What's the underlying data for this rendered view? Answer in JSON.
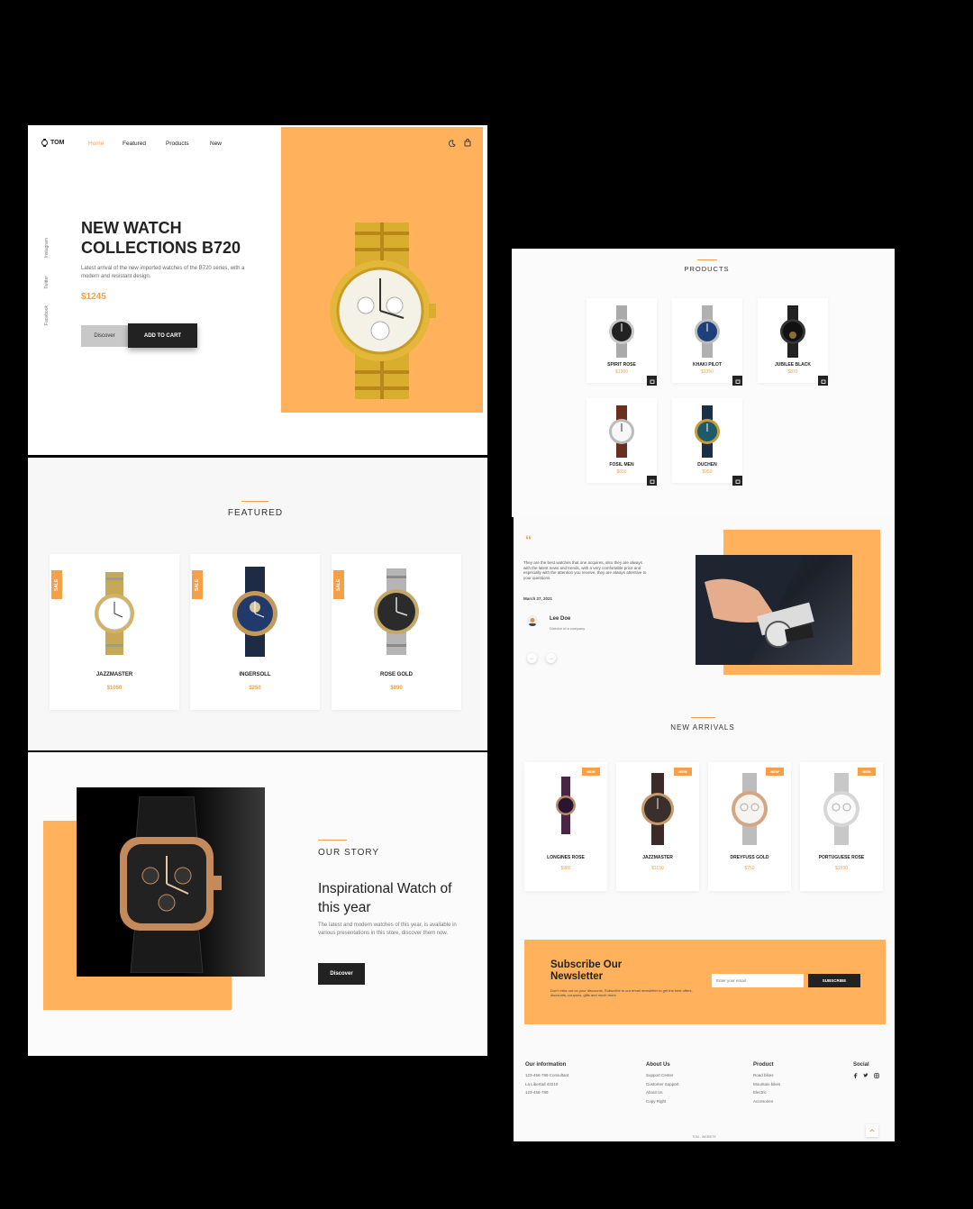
{
  "colors": {
    "accent": "#f4a04a",
    "orange_block": "#ffb25b",
    "dark_button": "#1f1f1f",
    "background": "#000000"
  },
  "header": {
    "logo": "TOM",
    "nav": [
      "Home",
      "Featured",
      "Products",
      "New"
    ],
    "active_nav": "Home",
    "icons": [
      "moon-icon",
      "bag-icon"
    ]
  },
  "hero": {
    "title_line1": "NEW WATCH",
    "title_line2": "COLLECTIONS B720",
    "description": "Latest arrival of the new imported watches of the B720 series, with a modern and resistant design.",
    "price": "$1245",
    "discover_label": "Discover",
    "add_to_cart_label": "ADD TO CART",
    "social": [
      "Instagram",
      "Twitter",
      "Facebook"
    ]
  },
  "featured": {
    "title": "FEATURED",
    "tag": "SALE",
    "items": [
      {
        "name": "JAZZMASTER",
        "price": "$1050"
      },
      {
        "name": "INGERSOLL",
        "price": "$250"
      },
      {
        "name": "ROSE GOLD",
        "price": "$890"
      }
    ]
  },
  "story": {
    "title": "OUR STORY",
    "heading_line1": "Inspirational Watch of",
    "heading_line2": "this year",
    "description": "The latest and modern watches of this year, is available in various presentations in this store, discover them now.",
    "button": "Discover"
  },
  "products": {
    "title": "PRODUCTS",
    "items": [
      {
        "name": "SPIRIT ROSE",
        "price": "$1500"
      },
      {
        "name": "KHAKI PILOT",
        "price": "$1350"
      },
      {
        "name": "JUBILEE BLACK",
        "price": "$870"
      },
      {
        "name": "FOSIL MEN",
        "price": "$650"
      },
      {
        "name": "DUCHEN",
        "price": "$950"
      }
    ]
  },
  "testimonial": {
    "quote_mark": "“",
    "text": "They are the best watches that one acquires, also they are always with the latest news and trends, with a very comfortable price and especially with the attention you receive, they are always attentive to your questions.",
    "date": "March 27, 2021",
    "name": "Lee Doe",
    "role": "Director of a company",
    "prev": "←",
    "next": "→"
  },
  "new_arrivals": {
    "title": "NEW ARRIVALS",
    "tag": "NEW",
    "items": [
      {
        "name": "LONGINES ROSE",
        "price": "$980"
      },
      {
        "name": "JAZZMASTER",
        "price": "$1150"
      },
      {
        "name": "DREYFUSS GOLD",
        "price": "$750"
      },
      {
        "name": "PORTUGUESE ROSE",
        "price": "$1590"
      }
    ]
  },
  "newsletter": {
    "title_line1": "Subscribe Our",
    "title_line2": "Newsletter",
    "description": "Don't miss out on your discounts. Subscribe to our email newsletter to get the best offers, discounts, coupons, gifts and much more.",
    "placeholder": "Enter your email",
    "button": "SUBSCRIBE"
  },
  "footer": {
    "columns": [
      {
        "title": "Our information",
        "items": [
          "123-456-789 Consultant",
          "La Libertad 43210",
          "123-456-789"
        ]
      },
      {
        "title": "About Us",
        "items": [
          "Support Center",
          "Customer Support",
          "About Us",
          "Copy Right"
        ]
      },
      {
        "title": "Product",
        "items": [
          "Road bikes",
          "Mountain bikes",
          "Electric",
          "Accesories"
        ]
      }
    ],
    "social_title": "Social",
    "copyright": "TOM - WEBSITE"
  }
}
